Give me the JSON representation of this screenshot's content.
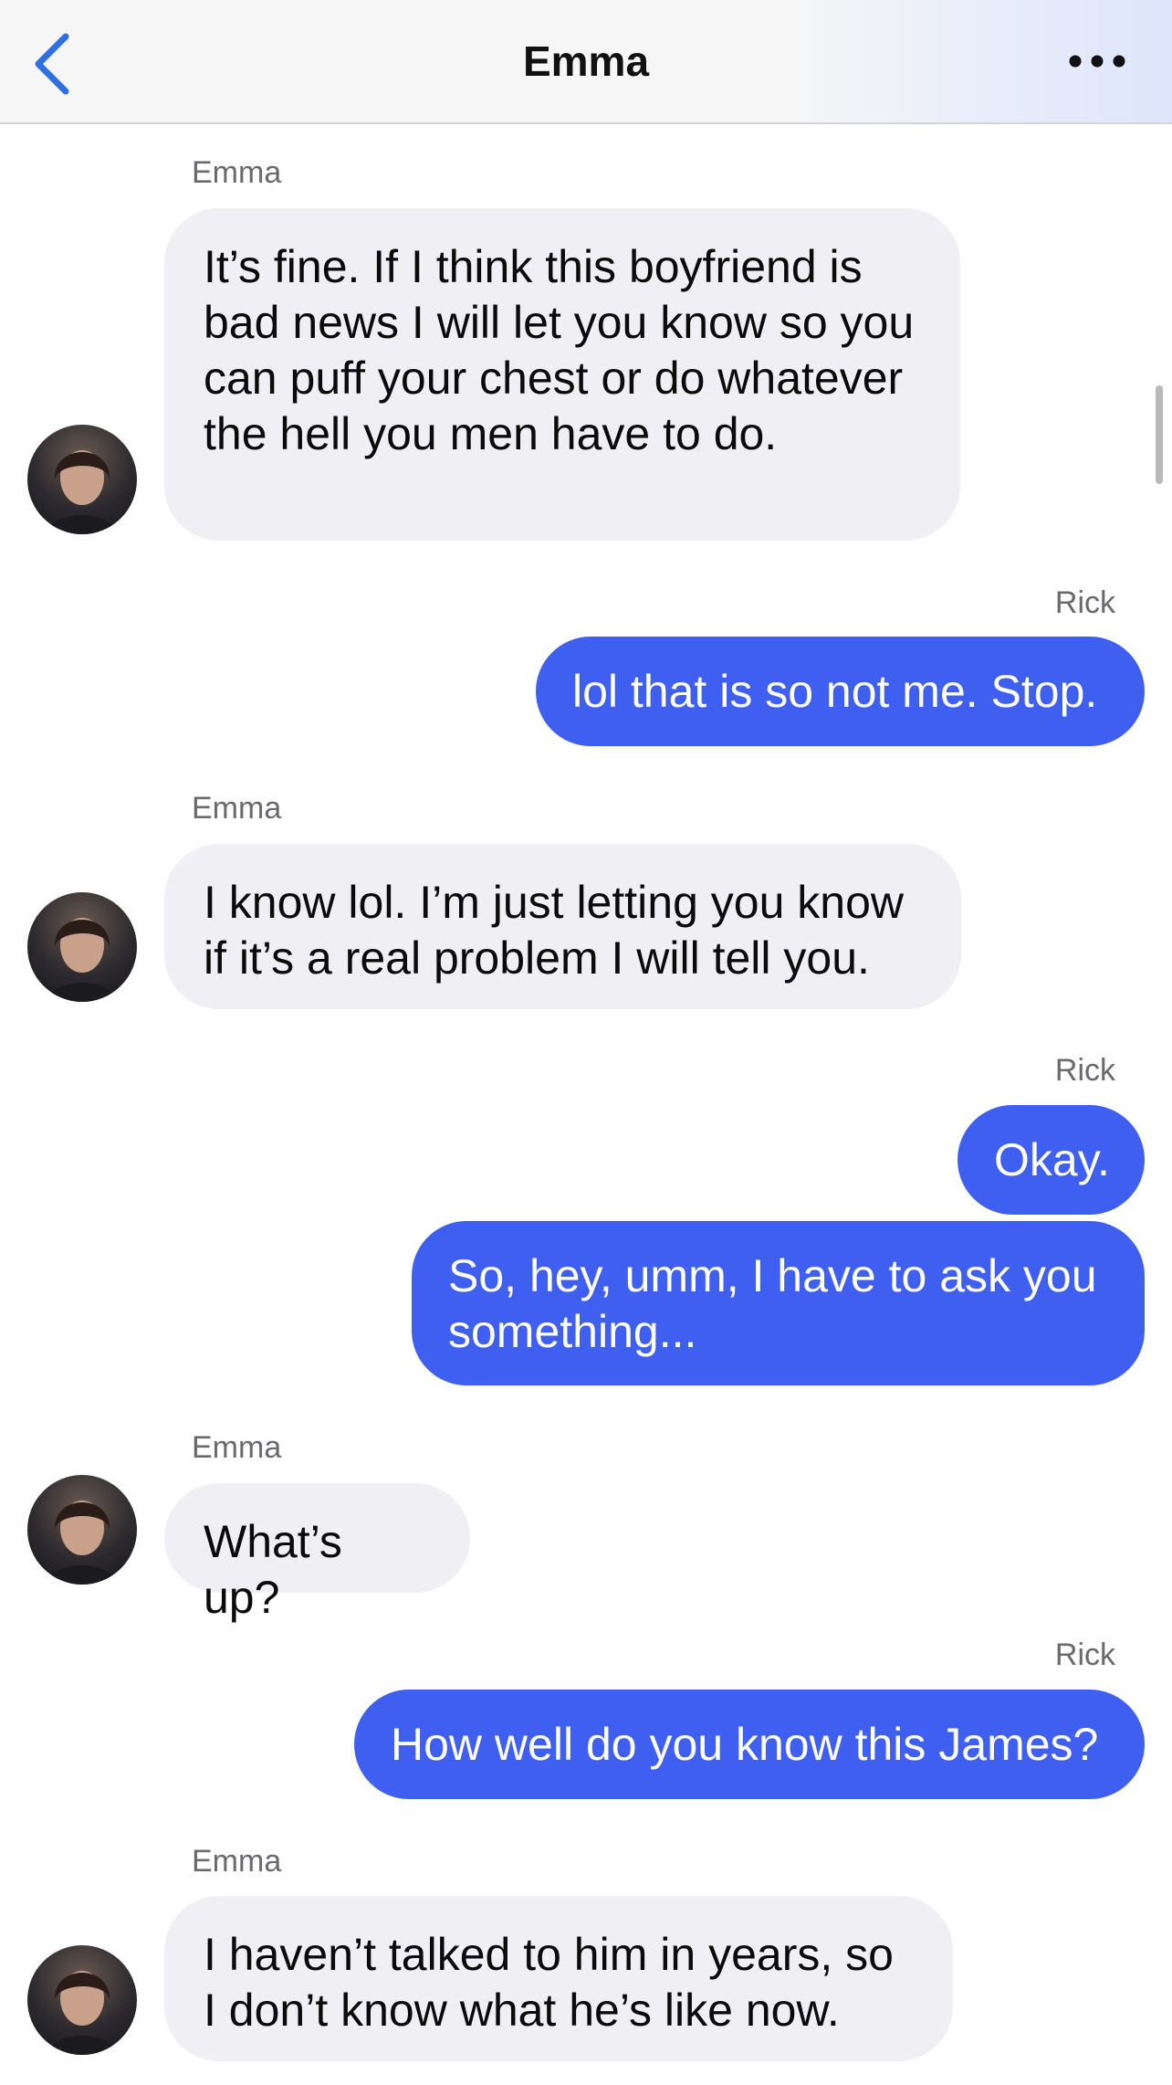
{
  "header": {
    "title": "Emma",
    "back_icon": "chevron-left-icon",
    "more_icon": "ellipsis-icon"
  },
  "colors": {
    "outgoing_bubble": "#3f5ff0",
    "incoming_bubble": "#efeff4",
    "back_icon": "#2f6fe0"
  },
  "messages": [
    {
      "sender": "Emma",
      "text": "It’s fine. If I think this boyfriend is bad news I will let you know so you can puff your chest or do whatever the hell you men have to do."
    },
    {
      "sender": "Rick",
      "text": "lol that is so not me. Stop."
    },
    {
      "sender": "Emma",
      "text": "I know lol. I’m just letting you know if it’s a real problem I will tell you."
    },
    {
      "sender": "Rick",
      "text": "Okay."
    },
    {
      "sender": "Rick",
      "text": "So, hey, umm, I have to ask you something..."
    },
    {
      "sender": "Emma",
      "text": "What’s up?"
    },
    {
      "sender": "Rick",
      "text": "How well do you know this James?"
    },
    {
      "sender": "Emma",
      "text": "I haven’t talked to him in years, so I don’t know what he’s like now."
    }
  ]
}
